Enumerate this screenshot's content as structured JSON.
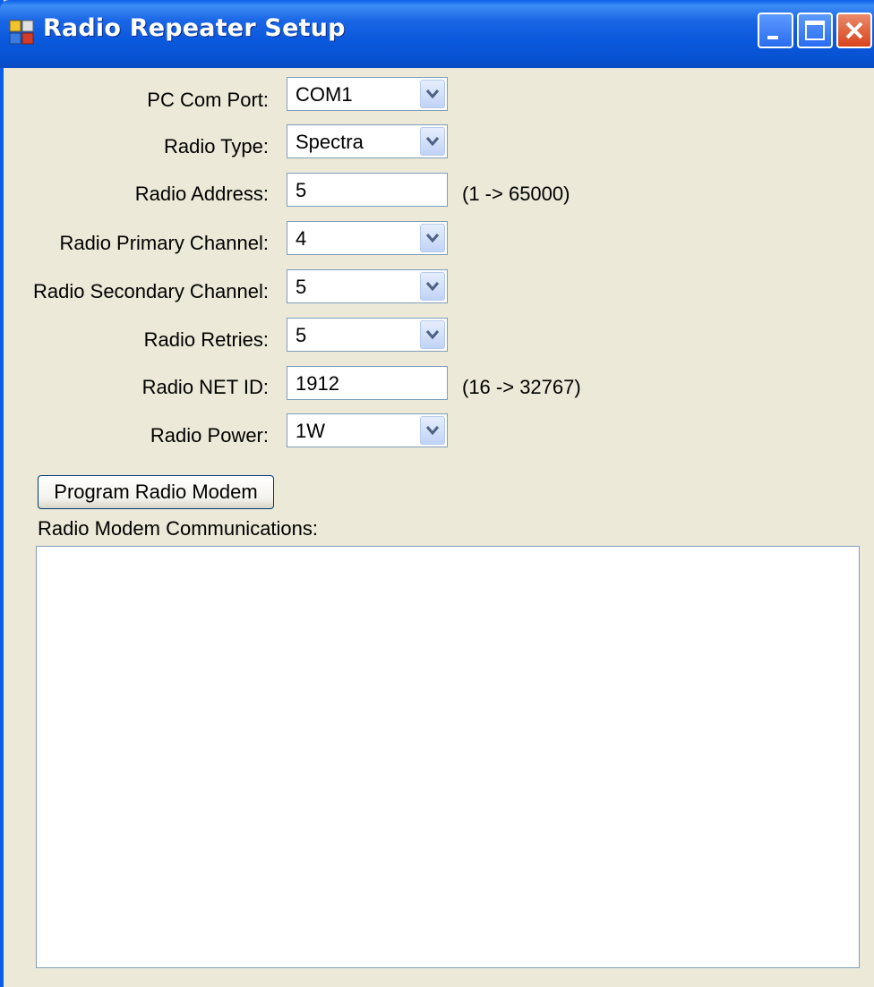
{
  "window": {
    "title": "Radio Repeater Setup",
    "buttons": [
      "minimize-icon",
      "maximize-icon",
      "close-icon"
    ]
  },
  "form": {
    "com_port": {
      "label": "PC Com Port:",
      "value": "COM1"
    },
    "radio_type": {
      "label": "Radio Type:",
      "value": "Spectra"
    },
    "radio_address": {
      "label": "Radio Address:",
      "value": "5",
      "range": "(1 -> 65000)"
    },
    "primary_channel": {
      "label": "Radio Primary Channel:",
      "value": "4"
    },
    "secondary_channel": {
      "label": "Radio Secondary Channel:",
      "value": "5"
    },
    "retries": {
      "label": "Radio Retries:",
      "value": "5"
    },
    "net_id": {
      "label": "Radio NET ID:",
      "value": "1912",
      "range": "(16 -> 32767)"
    },
    "power": {
      "label": "Radio Power:",
      "value": "1W"
    }
  },
  "actions": {
    "program_label": "Program Radio Modem"
  },
  "communications": {
    "label": "Radio Modem Communications:",
    "content": ""
  },
  "colors": {
    "titlebar": "#0a5ee8",
    "window_bg": "#ece9d8",
    "field_border": "#7f9db9"
  }
}
